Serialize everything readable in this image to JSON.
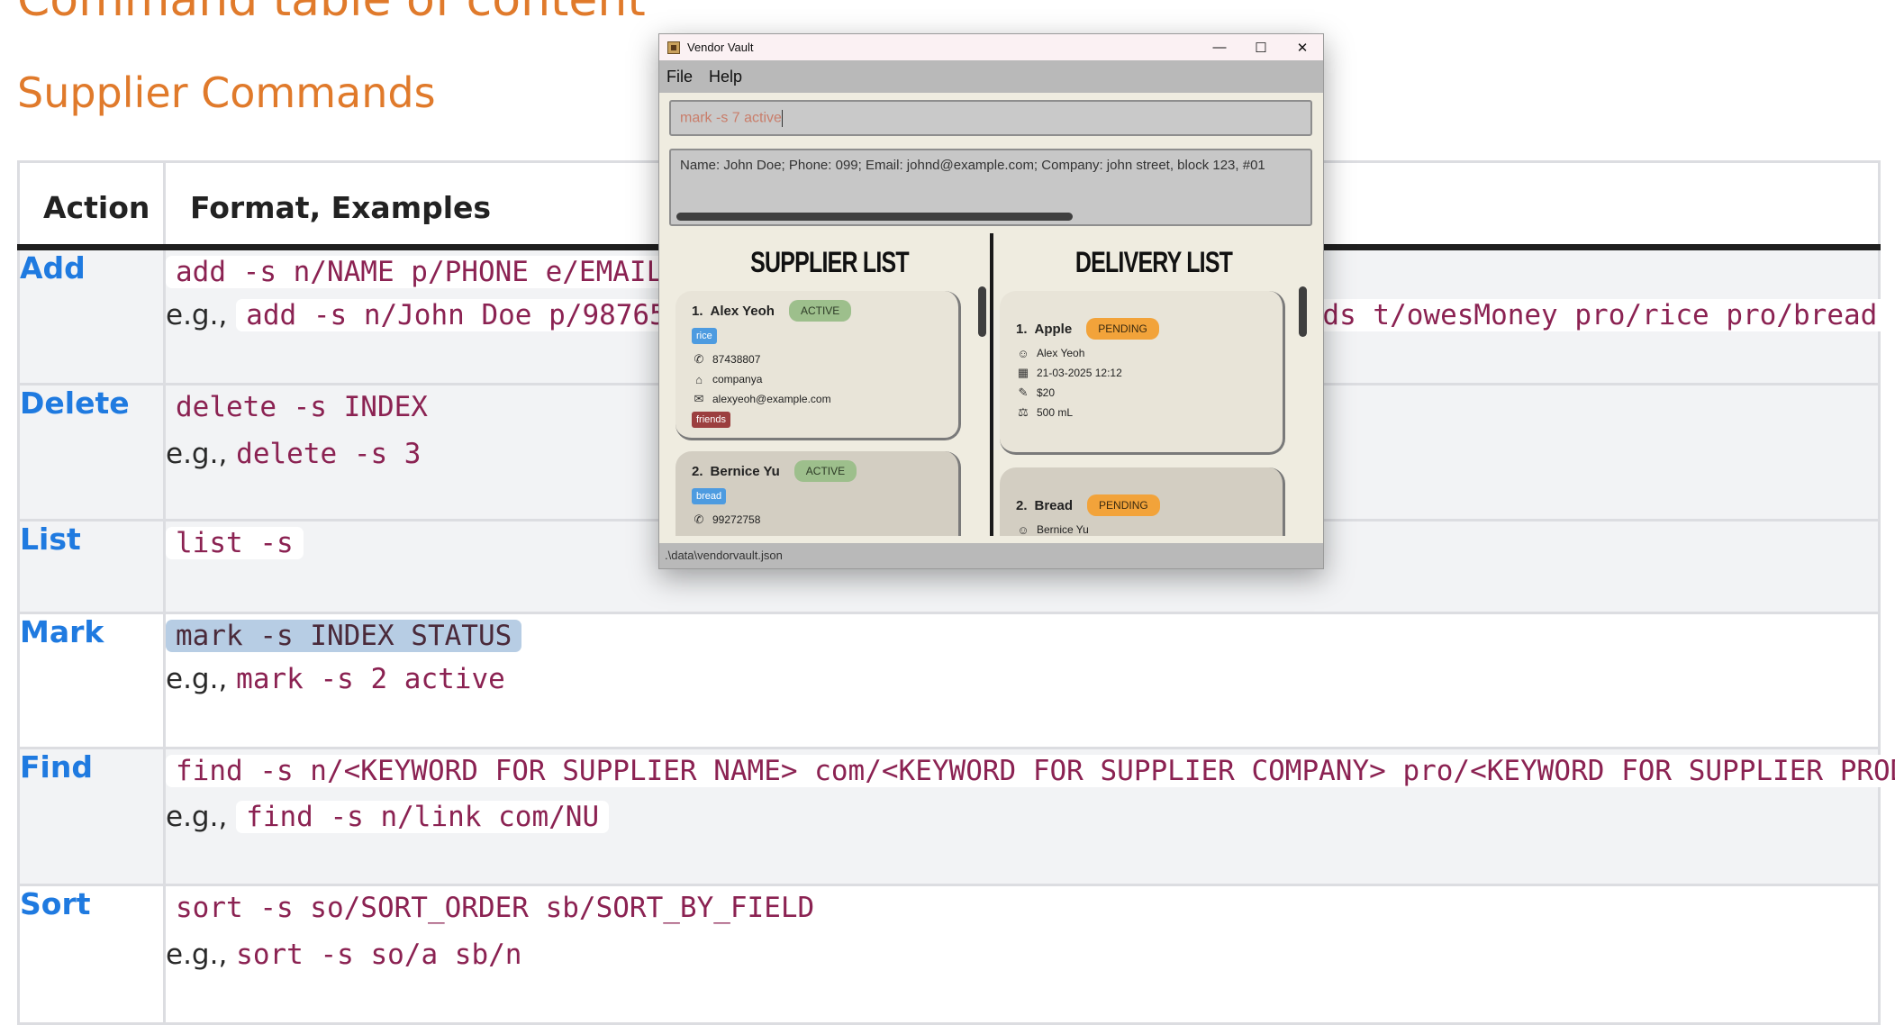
{
  "doc": {
    "heading": "Command table of content",
    "section": "Supplier Commands",
    "columns": [
      "Action",
      "Format, Examples"
    ],
    "eg_prefix": "e.g.,",
    "rows": [
      {
        "action": "Add",
        "format": "add -s n/NAME p/PHONE e/EMAIL",
        "example": "add -s n/John Doe p/98765",
        "example_tail": "nds t/owesMoney pro/rice pro/bread"
      },
      {
        "action": "Delete",
        "format": "delete -s INDEX",
        "example": "delete -s 3"
      },
      {
        "action": "List",
        "format": "list -s"
      },
      {
        "action": "Mark",
        "format": "mark -s INDEX STATUS",
        "example": "mark -s 2 active"
      },
      {
        "action": "Find",
        "format": "find -s n/<KEYWORD FOR SUPPLIER NAME> com/<KEYWORD FOR SUPPLIER COMPANY> pro/<KEYWORD FOR SUPPLIER PRODUCT>",
        "example": "find -s n/link com/NU"
      },
      {
        "action": "Sort",
        "format": "sort -s so/SORT_ORDER sb/SORT_BY_FIELD",
        "example": "sort -s so/a sb/n"
      }
    ]
  },
  "window": {
    "title": "Vendor Vault",
    "controls": {
      "minimize": "—",
      "maximize": "☐",
      "close": "✕"
    },
    "menu": [
      "File",
      "Help"
    ],
    "command_input": "mark -s 7 active",
    "result_text": "Name: John Doe; Phone: 099; Email: johnd@example.com; Company: john street, block 123, #01",
    "supplier_panel": {
      "title": "SUPPLIER LIST",
      "cards": [
        {
          "index": "1.",
          "name": "Alex Yeoh",
          "status": "ACTIVE",
          "product": "rice",
          "phone": "87438807",
          "company": "companya",
          "email": "alexyeoh@example.com",
          "tag": "friends"
        },
        {
          "index": "2.",
          "name": "Bernice Yu",
          "status": "ACTIVE",
          "product": "bread",
          "phone": "99272758"
        }
      ]
    },
    "delivery_panel": {
      "title": "DELIVERY LIST",
      "cards": [
        {
          "index": "1.",
          "name": "Apple",
          "status": "PENDING",
          "supplier": "Alex Yeoh",
          "date": "21-03-2025 12:12",
          "cost": "$20",
          "quantity": "500 mL"
        },
        {
          "index": "2.",
          "name": "Bread",
          "status": "PENDING",
          "supplier": "Bernice Yu"
        }
      ]
    },
    "status_bar": ".\\data\\vendorvault.json"
  }
}
